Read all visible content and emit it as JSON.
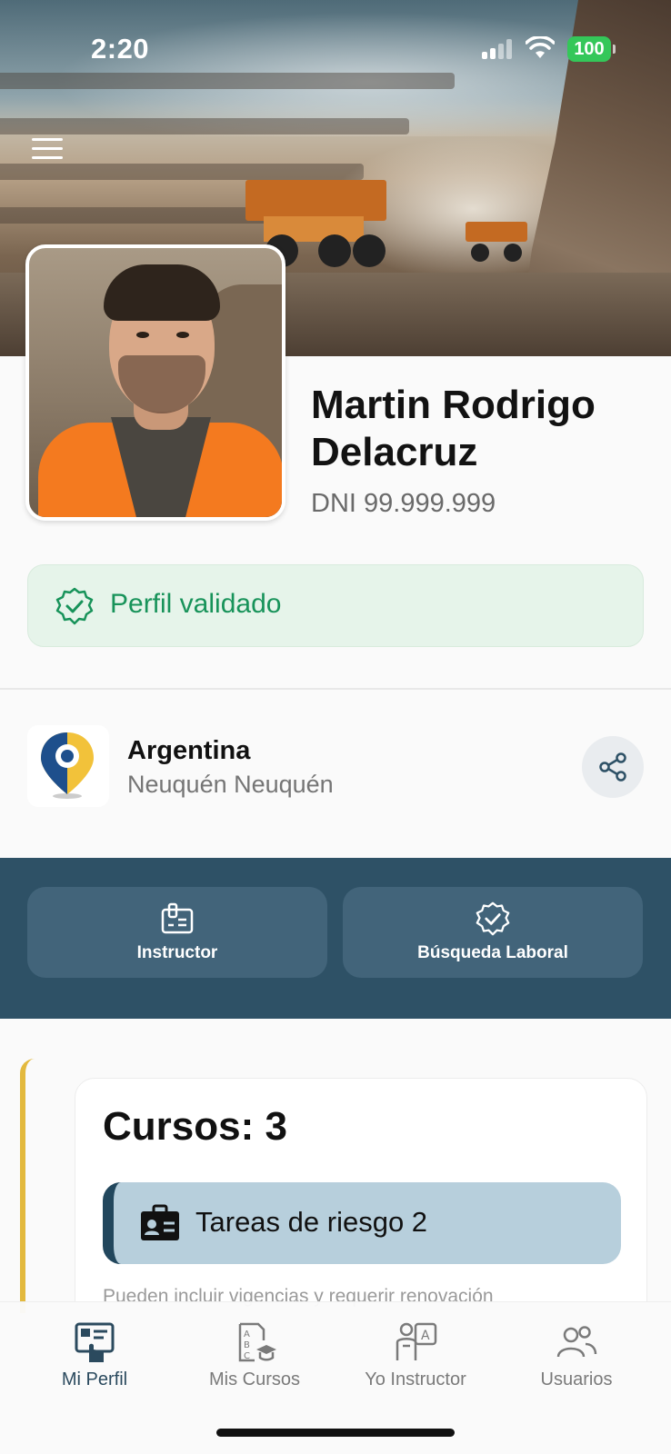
{
  "status_bar": {
    "time": "2:20",
    "battery": "100"
  },
  "profile": {
    "name": "Martin Rodrigo Delacruz",
    "dni": "DNI 99.999.999",
    "validated_label": "Perfil validado"
  },
  "location": {
    "country": "Argentina",
    "region": "Neuquén Neuquén"
  },
  "roles": [
    {
      "label": "Instructor",
      "icon": "id-card-clip-icon"
    },
    {
      "label": "Búsqueda Laboral",
      "icon": "badge-check-icon"
    }
  ],
  "cursos": {
    "title": "Cursos: 3",
    "tarea_label": "Tareas de riesgo 2",
    "note": "Pueden incluir vigencias y requerir renovación"
  },
  "bottom_nav": [
    {
      "label": "Mi Perfil",
      "icon": "profile-card-icon",
      "active": true
    },
    {
      "label": "Mis Cursos",
      "icon": "courses-icon",
      "active": false
    },
    {
      "label": "Yo Instructor",
      "icon": "instructor-icon",
      "active": false
    },
    {
      "label": "Usuarios",
      "icon": "users-icon",
      "active": false
    }
  ],
  "colors": {
    "accent_dark": "#2e5166",
    "validated_green": "#18935a",
    "accent_yellow": "#e3b93e",
    "tarea_bg": "#b7cfdc"
  }
}
